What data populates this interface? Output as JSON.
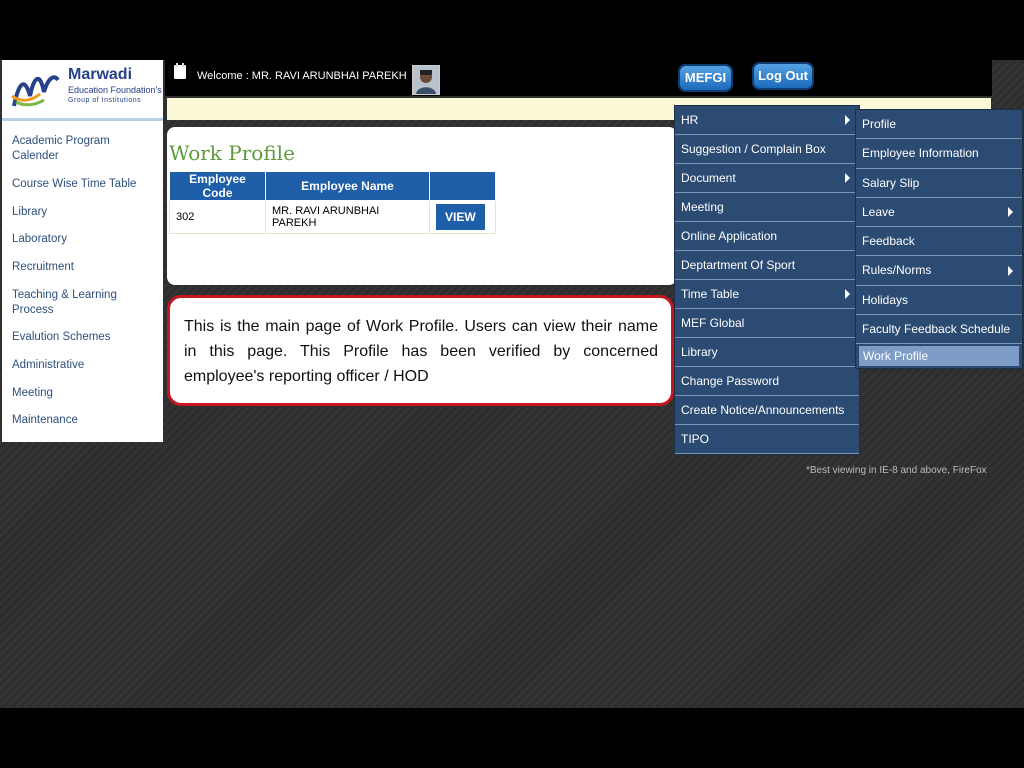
{
  "header": {
    "logo": {
      "brand": "Marwadi",
      "line1": "Education Foundation's",
      "line2": "Group of Institutions"
    },
    "welcome_text": "Welcome : MR. RAVI ARUNBHAI PAREKH",
    "mefgi_label": "MEFGI",
    "logout_label": "Log Out"
  },
  "sidebar": {
    "items": [
      {
        "label": "Academic Program Calender"
      },
      {
        "label": "Course Wise Time Table"
      },
      {
        "label": "Library"
      },
      {
        "label": "Laboratory"
      },
      {
        "label": "Recruitment"
      },
      {
        "label": "Teaching & Learning Process"
      },
      {
        "label": "Evalution Schemes"
      },
      {
        "label": "Administrative"
      },
      {
        "label": "Meeting"
      },
      {
        "label": "Maintenance"
      }
    ]
  },
  "main": {
    "title": "Work Profile",
    "table": {
      "columns": [
        "Employee Code",
        "Employee Name",
        ""
      ],
      "rows": [
        {
          "code": "302",
          "name": "MR. RAVI ARUNBHAI PAREKH",
          "action": "VIEW"
        }
      ]
    }
  },
  "callout": {
    "text": "This is the main page of Work Profile. Users can view their name in this page. This Profile has been verified by concerned employee's reporting officer / HOD"
  },
  "menu": {
    "items": [
      {
        "label": "HR",
        "submenu": true
      },
      {
        "label": "Suggestion / Complain Box",
        "submenu": false
      },
      {
        "label": "Document",
        "submenu": true
      },
      {
        "label": "Meeting",
        "submenu": false
      },
      {
        "label": "Online Application",
        "submenu": false
      },
      {
        "label": "Deptartment Of Sport",
        "submenu": false
      },
      {
        "label": "Time Table",
        "submenu": true
      },
      {
        "label": "MEF Global",
        "submenu": false
      },
      {
        "label": "Library",
        "submenu": false
      },
      {
        "label": "Change Password",
        "submenu": false
      },
      {
        "label": "Create Notice/Announcements",
        "submenu": false
      },
      {
        "label": "TIPO",
        "submenu": false
      }
    ]
  },
  "hr_submenu": {
    "items": [
      {
        "label": "Profile",
        "submenu": false
      },
      {
        "label": "Employee Information",
        "submenu": false
      },
      {
        "label": "Salary Slip",
        "submenu": false
      },
      {
        "label": "Leave",
        "submenu": true
      },
      {
        "label": "Feedback",
        "submenu": false
      },
      {
        "label": "Rules/Norms",
        "submenu": true
      },
      {
        "label": "Holidays",
        "submenu": false
      },
      {
        "label": "Faculty Feedback Schedule",
        "submenu": false
      },
      {
        "label": "Work Profile",
        "submenu": false,
        "active": true
      }
    ]
  },
  "footer_note": "*Best viewing in IE-8 and above, FireFox",
  "colors": {
    "header_bg": "#000000",
    "menu_bg": "#2c4b72",
    "accent_blue": "#1f5ea8",
    "title_green": "#5d9b3a",
    "callout_border": "#c4161c"
  }
}
